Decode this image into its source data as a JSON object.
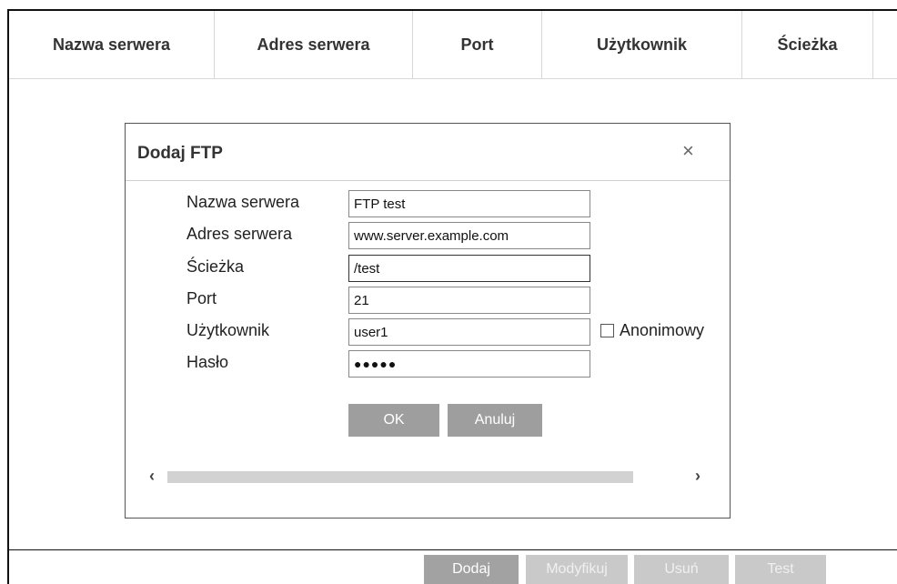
{
  "table": {
    "columns": [
      "Nazwa serwera",
      "Adres serwera",
      "Port",
      "Użytkownik",
      "Ścieżka",
      ""
    ]
  },
  "dialog": {
    "title": "Dodaj FTP",
    "close_glyph": "×",
    "fields": [
      {
        "label": "Nazwa serwera",
        "value": "FTP test"
      },
      {
        "label": "Adres serwera",
        "value": "www.server.example.com"
      },
      {
        "label": "Ścieżka",
        "value": "/test"
      },
      {
        "label": "Port",
        "value": "21"
      },
      {
        "label": "Użytkownik",
        "value": "user1"
      },
      {
        "label": "Hasło",
        "value": "●●●●●"
      }
    ],
    "anonymous_label": "Anonimowy",
    "ok_label": "OK",
    "cancel_label": "Anuluj",
    "scroll_left": "‹",
    "scroll_right": "›"
  },
  "toolbar": {
    "add_label": "Dodaj",
    "modify_label": "Modyfikuj",
    "delete_label": "Usuń",
    "test_label": "Test"
  }
}
